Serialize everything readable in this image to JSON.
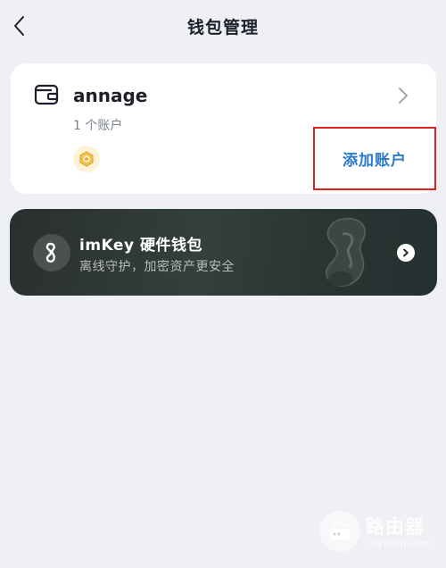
{
  "header": {
    "title": "钱包管理",
    "back_icon": "chevron-left-icon"
  },
  "wallet": {
    "icon": "wallet-icon",
    "name": "annage",
    "account_count": "1 个账户",
    "chain_icon": "cube-icon",
    "add_account_label": "添加账户",
    "highlight_color": "#e02020",
    "accent_color": "#2a78c8"
  },
  "imkey": {
    "title": "imKey 硬件钱包",
    "subtitle": "离线守护，加密资产更安全",
    "badge_icon": "imkey-logo-icon",
    "arrow_icon": "chevron-right-circle-icon"
  },
  "watermark": {
    "text": "路由器",
    "url": "luyouqi.com"
  }
}
